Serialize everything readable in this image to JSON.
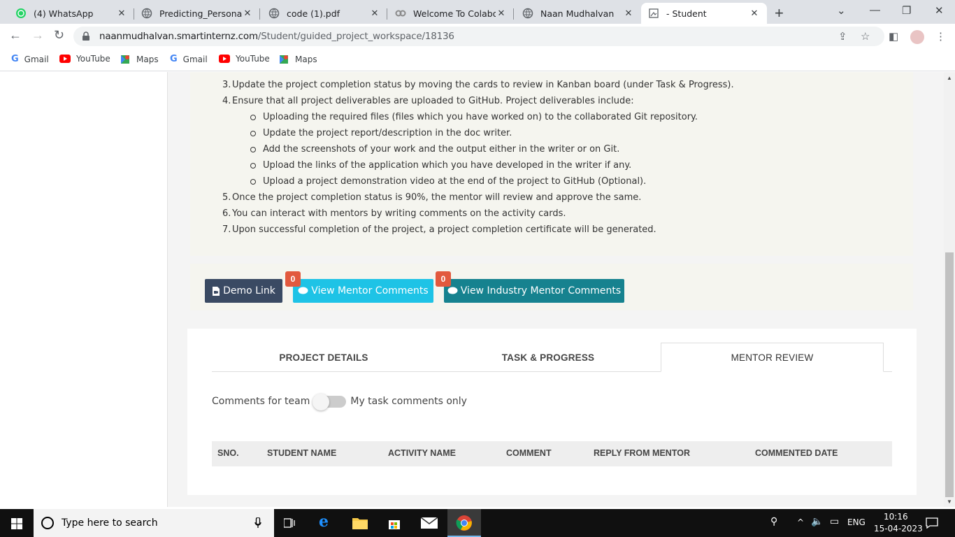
{
  "browser": {
    "tabs": [
      {
        "label": "(4) WhatsApp",
        "icon": "whatsapp-icon"
      },
      {
        "label": "Predicting_Personal_Lo",
        "icon": "globe-icon"
      },
      {
        "label": "code (1).pdf",
        "icon": "globe-icon"
      },
      {
        "label": "Welcome To Colabora",
        "icon": "colab-icon"
      },
      {
        "label": "Naan Mudhalvan",
        "icon": "globe-icon"
      },
      {
        "label": "- Student",
        "icon": "page-icon"
      }
    ],
    "url_host": "naanmudhalvan.smartinternz.com",
    "url_path": "/Student/guided_project_workspace/18136",
    "bookmarks": [
      {
        "label": "Gmail",
        "icon": "google-icon"
      },
      {
        "label": "YouTube",
        "icon": "youtube-icon"
      },
      {
        "label": "Maps",
        "icon": "maps-icon"
      },
      {
        "label": "Gmail",
        "icon": "google-icon"
      },
      {
        "label": "YouTube",
        "icon": "youtube-icon"
      },
      {
        "label": "Maps",
        "icon": "maps-icon"
      }
    ]
  },
  "instructions": {
    "items": [
      {
        "num": "3.",
        "text": "Update the project completion status by moving the cards to review in Kanban board (under Task & Progress)."
      },
      {
        "num": "4.",
        "text": "Ensure that all project deliverables are uploaded to GitHub. Project deliverables include:"
      },
      {
        "num": "5.",
        "text": "Once the project completion status is 90%, the mentor will review and approve the same."
      },
      {
        "num": "6.",
        "text": "You can interact with mentors by writing comments on the activity cards."
      },
      {
        "num": "7.",
        "text": "Upon successful completion of the project, a project completion certificate will be generated."
      }
    ],
    "sub_items": [
      "Uploading the required files (files which you have worked on) to the collaborated Git repository.",
      "Update the project report/description in the doc writer.",
      "Add the screenshots of your work and the output either in the writer or on Git.",
      "Upload the links of the application which you have developed in the writer if any.",
      "Upload a project demonstration video at the end of the project to GitHub (Optional)."
    ]
  },
  "actions": {
    "demo_label": "Demo Link",
    "mentor_label": "View Mentor Comments",
    "mentor_count": "0",
    "industry_label": "View Industry Mentor Comments",
    "industry_count": "0"
  },
  "panel": {
    "tabs": [
      "PROJECT DETAILS",
      "TASK & PROGRESS",
      "MENTOR REVIEW"
    ],
    "active_tab": "MENTOR REVIEW",
    "toggle_left": "Comments for team",
    "toggle_right": "My task comments only",
    "columns": [
      "SNO.",
      "STUDENT NAME",
      "ACTIVITY NAME",
      "COMMENT",
      "REPLY FROM MENTOR",
      "COMMENTED DATE"
    ]
  },
  "taskbar": {
    "search_placeholder": "Type here to search",
    "lang": "ENG",
    "time": "10:16",
    "date": "15-04-2023"
  },
  "colors": {
    "demo_button": "#3a4a63",
    "mentor_button": "#1ec3e6",
    "industry_button": "#16828f",
    "badge": "#e2593e"
  }
}
